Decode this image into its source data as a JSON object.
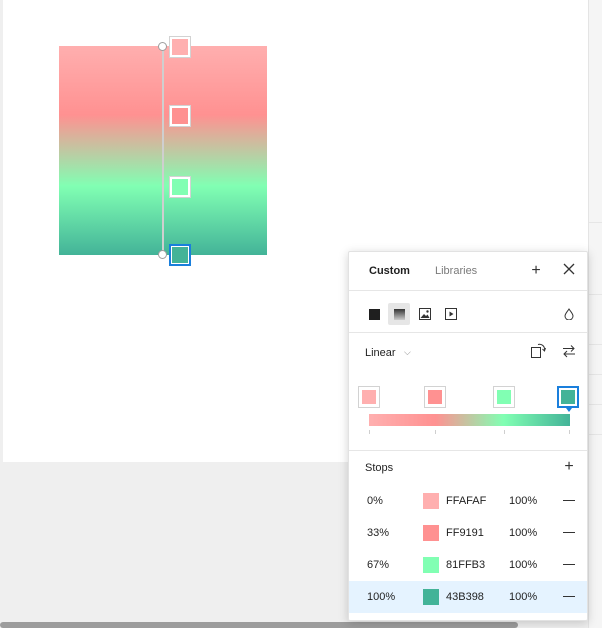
{
  "panel": {
    "tabs": [
      {
        "label": "Custom",
        "active": true
      },
      {
        "label": "Libraries",
        "active": false
      }
    ],
    "icons": {
      "add": "plus-icon",
      "close": "close-icon",
      "solid": "solid-fill-icon",
      "gradient": "gradient-fill-icon",
      "image": "image-fill-icon",
      "video": "video-fill-icon",
      "blend": "blend-mode-icon",
      "rotate": "rotate-gradient-icon",
      "flip": "flip-gradient-icon",
      "chevron": "chevron-down-icon",
      "add_stop": "plus-icon",
      "remove_stop": "minus-icon"
    },
    "gradient_type": "Linear",
    "stops_title": "Stops",
    "selected_stop": 3
  },
  "stops": [
    {
      "position": "0%",
      "hex": "FFAFAF",
      "color": "#FFAFAF",
      "opacity": "100%"
    },
    {
      "position": "33%",
      "hex": "FF9191",
      "color": "#FF9191",
      "opacity": "100%"
    },
    {
      "position": "67%",
      "hex": "81FFB3",
      "color": "#81FFB3",
      "opacity": "100%"
    },
    {
      "position": "100%",
      "hex": "43B398",
      "color": "#43B398",
      "opacity": "100%"
    }
  ],
  "accent_color": "#1A7FDC"
}
